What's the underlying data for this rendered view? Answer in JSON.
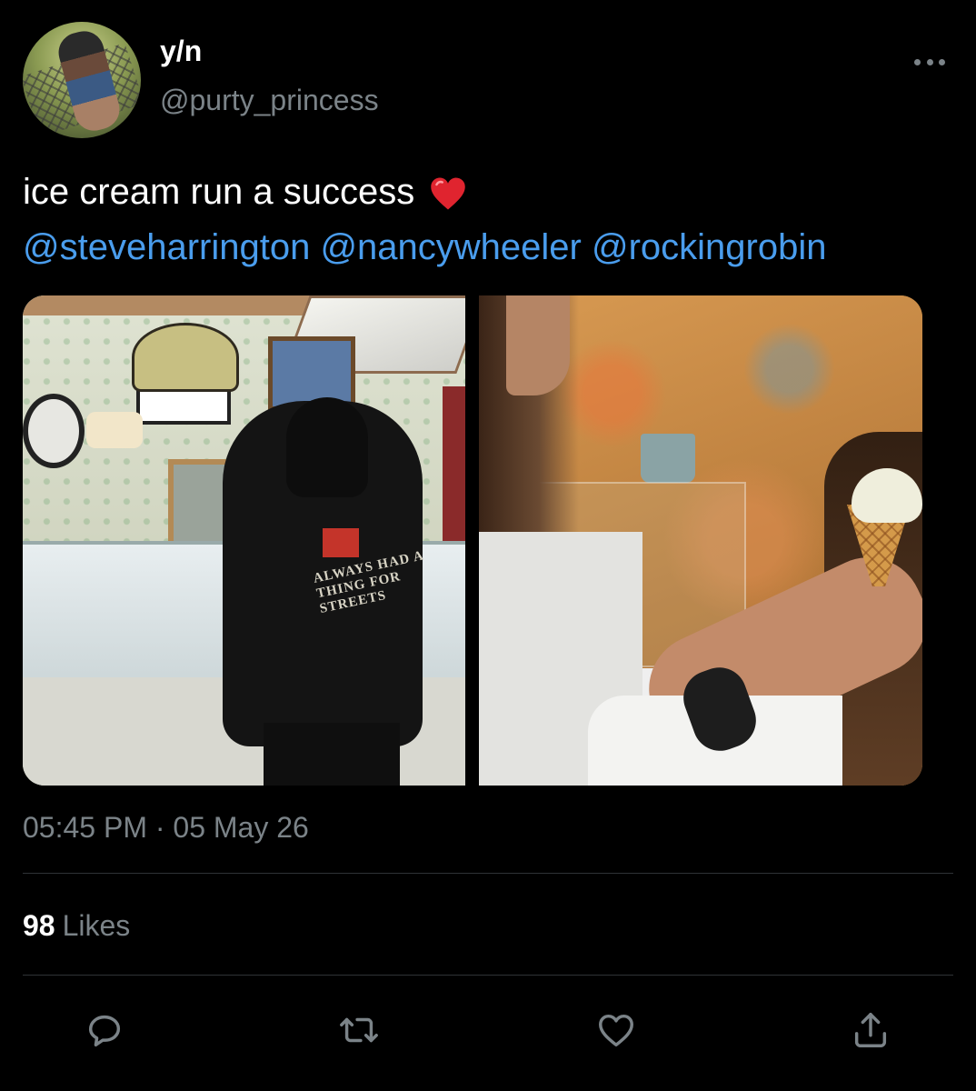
{
  "user": {
    "display_name": "y/n",
    "handle": "@purty_princess"
  },
  "tweet": {
    "text": "ice cream run a success",
    "emoji": "heart-emoji",
    "mentions": [
      "@steveharrington",
      "@nancywheeler",
      "@rockingrobin"
    ],
    "timestamp": "05:45 PM · 05 May 26",
    "images": [
      {
        "print_text": "ALWAYS HAD A THING FOR STREETS"
      },
      {}
    ]
  },
  "stats": {
    "likes_count": "98",
    "likes_label": "Likes"
  },
  "actions": [
    "reply-icon",
    "retweet-icon",
    "like-icon",
    "share-icon"
  ],
  "colors": {
    "background": "#000000",
    "text": "#ffffff",
    "secondary": "#7b8388",
    "link": "#4a9ded",
    "divider": "#2f3336",
    "emoji_heart": "#e0242f"
  }
}
